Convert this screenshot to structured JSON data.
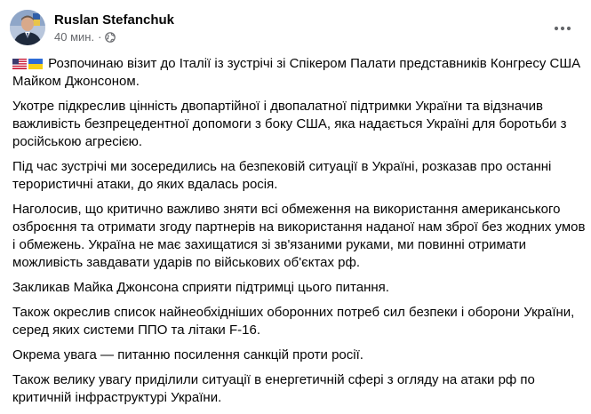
{
  "post": {
    "author": "Ruslan Stefanchuk",
    "time": "40 мин.",
    "separator": "·",
    "audience_icon": "globe-icon",
    "more_icon": "more-horizontal-icon",
    "flags": [
      "us-flag",
      "ukraine-flag"
    ],
    "paragraphs": [
      {
        "lines": [
          "Розпочинаю візит до Італії із зустрічі зі Спікером Палати представників Конгресу США",
          "Майком Джонсоном."
        ]
      },
      {
        "lines": [
          "Укотре підкреслив цінність двопартійної і двопалатної підтримки України та відзначив",
          "важливість безпрецедентної допомоги з боку США, яка надається Україні для боротьби з",
          "російською агресією."
        ]
      },
      {
        "lines": [
          "Під час зустрічі ми зосередились на безпековій ситуації в Україні, розказав про останні",
          "терористичні атаки, до яких вдалась росія."
        ]
      },
      {
        "lines": [
          "Наголосив, що критично важливо зняти всі обмеження на використання американського",
          "озброєння та отримати згоду партнерів на використання наданої нам зброї без жодних умов",
          "і обмежень. Україна не має захищатися зі зв'язаними руками, ми повинні отримати",
          "можливість завдавати ударів по військових об'єктах рф."
        ]
      },
      {
        "lines": [
          "Закликав Майка Джонсона сприяти підтримці цього питання."
        ]
      },
      {
        "lines": [
          "Також окреслив список найнеобхідніших оборонних потреб сил безпеки і оборони України,",
          "серед яких системи ППО та літаки F-16."
        ]
      },
      {
        "lines": [
          "Окрема увага — питанню посилення санкцій проти росії."
        ]
      },
      {
        "lines": [
          "Також велику увагу приділили ситуації в енергетичній сфері з огляду на атаки рф по",
          "критичній інфраструктурі України."
        ]
      }
    ]
  },
  "colors": {
    "text": "#050505",
    "secondary": "#65676b",
    "background": "#ffffff"
  }
}
